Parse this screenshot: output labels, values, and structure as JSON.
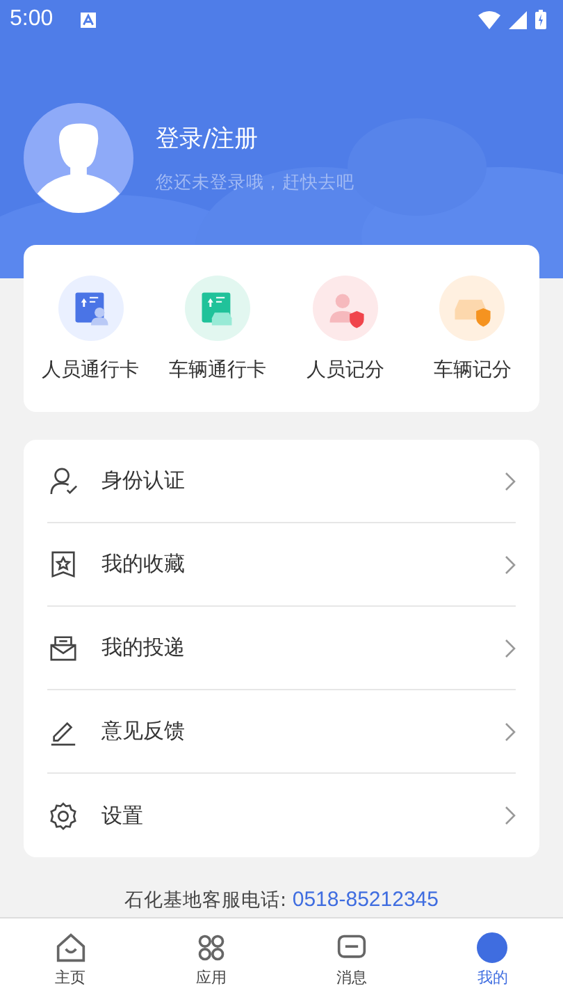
{
  "status_bar": {
    "time": "5:00"
  },
  "profile": {
    "title": "登录/注册",
    "subtitle": "您还未登录哦，赶快去吧"
  },
  "shortcuts": [
    {
      "kind": "person-pass",
      "label": "人员通行卡"
    },
    {
      "kind": "vehicle-pass",
      "label": "车辆通行卡"
    },
    {
      "kind": "person-score",
      "label": "人员记分"
    },
    {
      "kind": "vehicle-score",
      "label": "车辆记分"
    }
  ],
  "menu": [
    {
      "kind": "identity",
      "label": "身份认证"
    },
    {
      "kind": "favorites",
      "label": "我的收藏"
    },
    {
      "kind": "delivery",
      "label": "我的投递"
    },
    {
      "kind": "feedback",
      "label": "意见反馈"
    },
    {
      "kind": "settings",
      "label": "设置"
    }
  ],
  "hotline": {
    "label": "石化基地客服电话:",
    "phone": "0518-85212345"
  },
  "tabs": [
    {
      "kind": "home",
      "label": "主页",
      "selected": false
    },
    {
      "kind": "apps",
      "label": "应用",
      "selected": false
    },
    {
      "kind": "messages",
      "label": "消息",
      "selected": false
    },
    {
      "kind": "me",
      "label": "我的",
      "selected": true
    }
  ]
}
